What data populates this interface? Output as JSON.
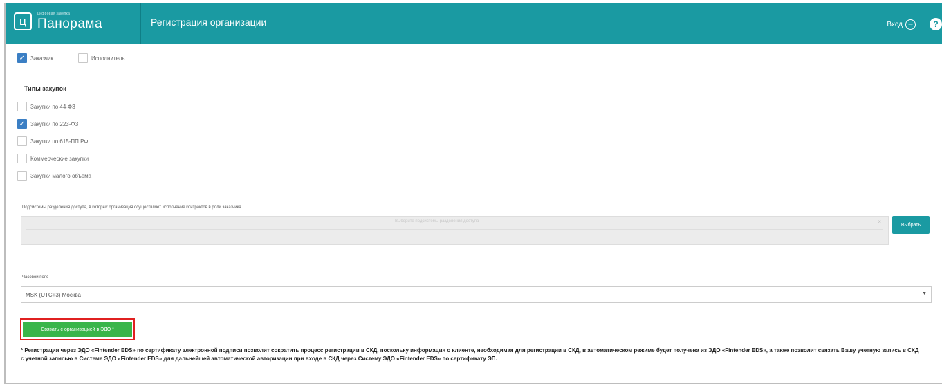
{
  "header": {
    "logo_sub": "цифровая закупка",
    "logo_main": "Панорама",
    "title": "Регистрация организации",
    "login_label": "Вход",
    "brand_color": "#1a9aa2"
  },
  "roles": [
    {
      "label": "Заказчик",
      "checked": true
    },
    {
      "label": "Исполнитель",
      "checked": false
    }
  ],
  "purchase_types": {
    "title": "Типы закупок",
    "items": [
      {
        "label": "Закупки по 44-ФЗ",
        "checked": false
      },
      {
        "label": "Закупки по 223-ФЗ",
        "checked": true
      },
      {
        "label": "Закупки по 615-ПП РФ",
        "checked": false
      },
      {
        "label": "Коммерческие закупки",
        "checked": false
      },
      {
        "label": "Закупки малого объема",
        "checked": false
      }
    ]
  },
  "subsystems": {
    "label": "Подсистемы разделения доступа, в которых организация осуществляет исполнение контрактов в роли заказчика",
    "placeholder": "Выберите подсистемы разделения доступа",
    "choose_label": "Выбрать"
  },
  "timezone": {
    "label": "Часовой пояс",
    "value": "MSK (UTC+3) Москва"
  },
  "edo_button_label": "Связать с организацией в ЭДО *",
  "note": "* Регистрация через ЭДО «Fintender EDS» по сертификату электронной подписи позволит сократить процесс регистрации в СКД, поскольку информация о клиенте, необходимая для регистрации в СКД, в автоматическом режиме будет получена из ЭДО «Fintender EDS», а также позволит связать Вашу учетную запись в СКД с учетной записью в Системе ЭДО «Fintender EDS» для дальнейшей автоматической авторизации при входе в СКД через Систему ЭДО «Fintender EDS» по сертификату ЭП."
}
